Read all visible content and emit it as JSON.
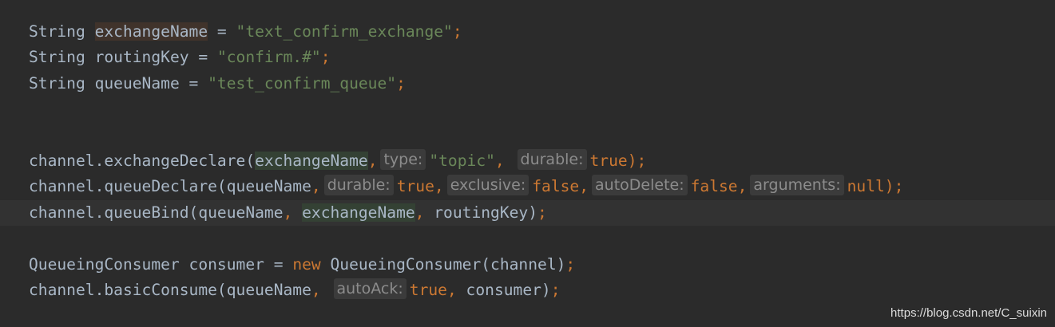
{
  "colors": {
    "background": "#2b2b2b",
    "current_line": "#323232",
    "identifier": "#a9b7c6",
    "string": "#6a8759",
    "keyword": "#cc7832",
    "hint_text": "#8c8c8c",
    "hint_background": "#3b3b3b",
    "highlight_read": "#344134",
    "highlight_declaration": "#40332b"
  },
  "code_lines": [
    {
      "tokens": [
        {
          "t": "String ",
          "k": "plain"
        },
        {
          "t": "exchangeName",
          "k": "plain",
          "hl": "decl"
        },
        {
          "t": " = ",
          "k": "plain"
        },
        {
          "t": "\"text_confirm_exchange\"",
          "k": "string"
        },
        {
          "t": ";",
          "k": "punct"
        }
      ]
    },
    {
      "tokens": [
        {
          "t": "String routingKey = ",
          "k": "plain"
        },
        {
          "t": "\"confirm.#\"",
          "k": "string"
        },
        {
          "t": ";",
          "k": "punct"
        }
      ]
    },
    {
      "tokens": [
        {
          "t": "String queueName = ",
          "k": "plain"
        },
        {
          "t": "\"test_confirm_queue\"",
          "k": "string"
        },
        {
          "t": ";",
          "k": "punct"
        }
      ]
    },
    {
      "tokens": []
    },
    {
      "tokens": []
    },
    {
      "tokens": [
        {
          "t": "channel.exchangeDeclare(",
          "k": "plain"
        },
        {
          "t": "exchangeName",
          "k": "plain",
          "hl": "read"
        },
        {
          "t": ",",
          "k": "punct"
        },
        {
          "hint": "type:"
        },
        {
          "t": "\"topic\"",
          "k": "string"
        },
        {
          "t": ",",
          "k": "punct"
        },
        {
          "t": " ",
          "k": "plain"
        },
        {
          "hint": "durable:"
        },
        {
          "t": "true",
          "k": "keyword"
        },
        {
          "t": ");",
          "k": "punct"
        }
      ]
    },
    {
      "tokens": [
        {
          "t": "channel.queueDeclare(queueName",
          "k": "plain"
        },
        {
          "t": ",",
          "k": "punct"
        },
        {
          "hint": "durable:"
        },
        {
          "t": "true",
          "k": "keyword"
        },
        {
          "t": ",",
          "k": "punct"
        },
        {
          "hint": "exclusive:"
        },
        {
          "t": "false",
          "k": "keyword"
        },
        {
          "t": ",",
          "k": "punct"
        },
        {
          "hint": "autoDelete:"
        },
        {
          "t": "false",
          "k": "keyword"
        },
        {
          "t": ",",
          "k": "punct"
        },
        {
          "hint": "arguments:"
        },
        {
          "t": "null",
          "k": "keyword"
        },
        {
          "t": ");",
          "k": "punct"
        }
      ]
    },
    {
      "current": true,
      "tokens": [
        {
          "t": "channel.queueBind(queueName",
          "k": "plain"
        },
        {
          "t": ",",
          "k": "punct"
        },
        {
          "t": " ",
          "k": "plain"
        },
        {
          "t": "exchangeName",
          "k": "plain",
          "hl": "read"
        },
        {
          "t": ",",
          "k": "punct"
        },
        {
          "t": " routingKey)",
          "k": "plain"
        },
        {
          "t": ";",
          "k": "punct"
        }
      ]
    },
    {
      "tokens": []
    },
    {
      "tokens": [
        {
          "t": "QueueingConsumer consumer = ",
          "k": "plain"
        },
        {
          "t": "new",
          "k": "keyword"
        },
        {
          "t": " QueueingConsumer(channel)",
          "k": "plain"
        },
        {
          "t": ";",
          "k": "punct"
        }
      ]
    },
    {
      "tokens": [
        {
          "t": "channel.basicConsume(queueName",
          "k": "plain"
        },
        {
          "t": ",",
          "k": "punct"
        },
        {
          "t": " ",
          "k": "plain"
        },
        {
          "hint": "autoAck:"
        },
        {
          "t": "true",
          "k": "keyword"
        },
        {
          "t": ",",
          "k": "punct"
        },
        {
          "t": " consumer)",
          "k": "plain"
        },
        {
          "t": ";",
          "k": "punct"
        }
      ]
    }
  ],
  "watermark": "https://blog.csdn.net/C_suixin"
}
